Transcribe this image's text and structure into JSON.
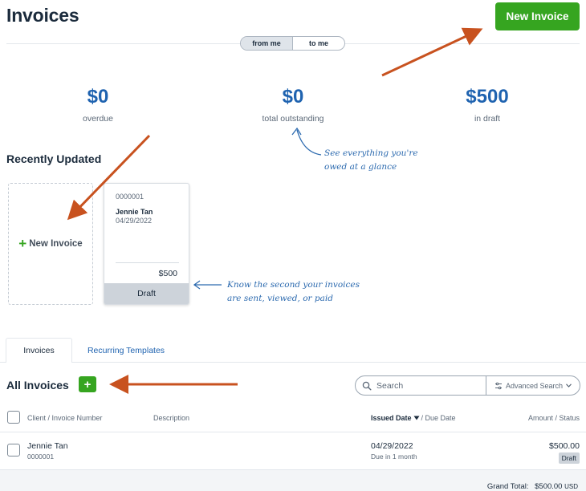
{
  "header": {
    "title": "Invoices",
    "new_invoice_label": "New Invoice",
    "toggle": {
      "from_me": "from me",
      "to_me": "to me"
    }
  },
  "summary": [
    {
      "amount": "$0",
      "label": "overdue"
    },
    {
      "amount": "$0",
      "label": "total outstanding"
    },
    {
      "amount": "$500",
      "label": "in draft"
    }
  ],
  "annotations": {
    "glance_line1": "See everything you're",
    "glance_line2": "owed at a glance",
    "status_line1": "Know the second your invoices",
    "status_line2": "are sent, viewed, or paid"
  },
  "recent": {
    "title": "Recently Updated",
    "new_card_label": "New Invoice",
    "card": {
      "number": "0000001",
      "client": "Jennie Tan",
      "date": "04/29/2022",
      "amount": "$500",
      "status": "Draft"
    }
  },
  "tabs": {
    "invoices": "Invoices",
    "recurring": "Recurring Templates"
  },
  "list": {
    "title": "All Invoices",
    "add_label": "+",
    "search_placeholder": "Search",
    "advanced_search": "Advanced Search",
    "columns": {
      "client": "Client / Invoice Number",
      "description": "Description",
      "issued": "Issued Date",
      "due": "/ Due Date",
      "amount": "Amount / Status"
    },
    "rows": [
      {
        "client": "Jennie Tan",
        "number": "0000001",
        "issued": "04/29/2022",
        "due": "Due in 1 month",
        "amount": "$500.00",
        "status": "Draft"
      }
    ],
    "grand_total_label": "Grand Total:",
    "grand_total_value": "$500.00",
    "currency": "USD"
  },
  "colors": {
    "accent_green": "#36a520",
    "link_blue": "#1f63b0",
    "arrow_orange": "#c8521f"
  },
  "icons": [
    "search-icon",
    "sliders-icon",
    "chevron-down-icon",
    "caret-down-icon",
    "plus-icon"
  ]
}
